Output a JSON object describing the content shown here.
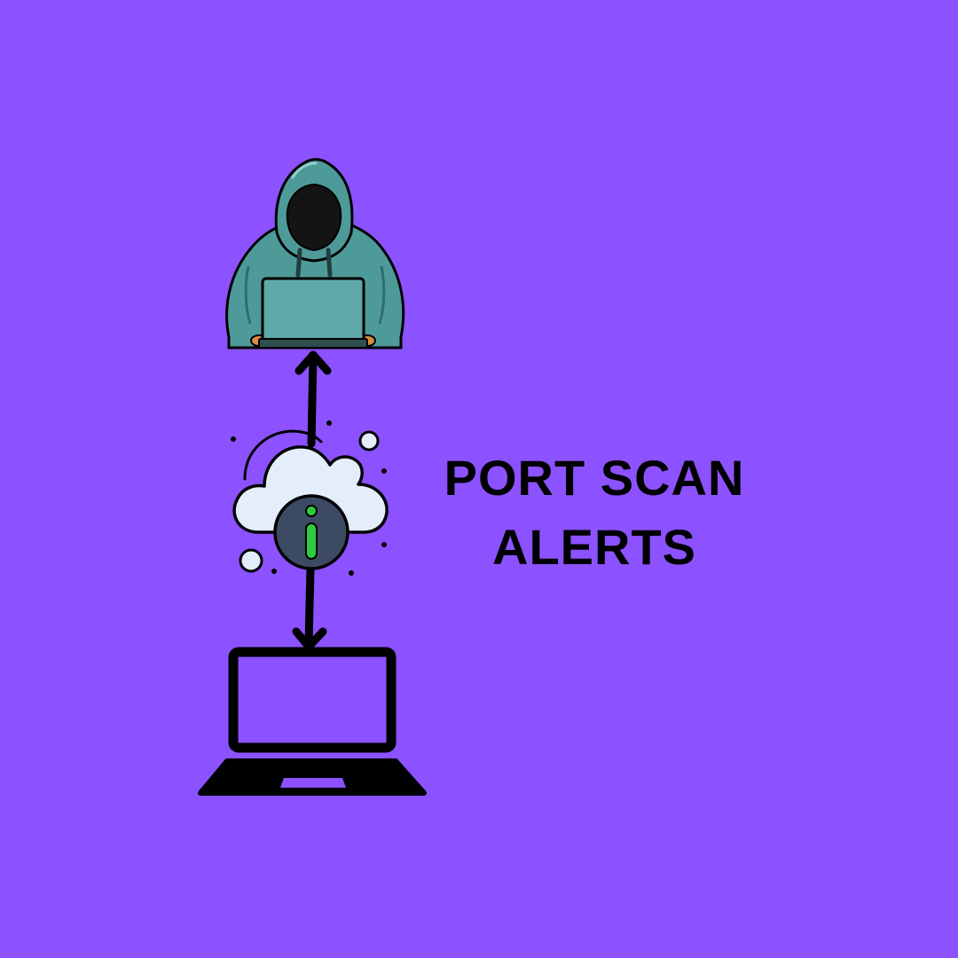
{
  "background_color": "#8c52ff",
  "title": {
    "line1": "PORT SCAN",
    "line2": "ALERTS"
  },
  "icons": {
    "attacker": "hooded-hacker-with-laptop-icon",
    "cloud": "cloud-info-icon",
    "target": "laptop-icon",
    "arrow_up": "arrow-up-icon",
    "arrow_down": "arrow-down-icon"
  },
  "colors": {
    "hoodie": "#4e9a99",
    "hoodie_dark": "#2f6e6d",
    "face": "#141414",
    "hacker_laptop": "#5fa8a8",
    "cloud": "#e4eefb",
    "info_circle": "#3d4a64",
    "info_glyph": "#2ecc40",
    "outline": "#000000"
  }
}
